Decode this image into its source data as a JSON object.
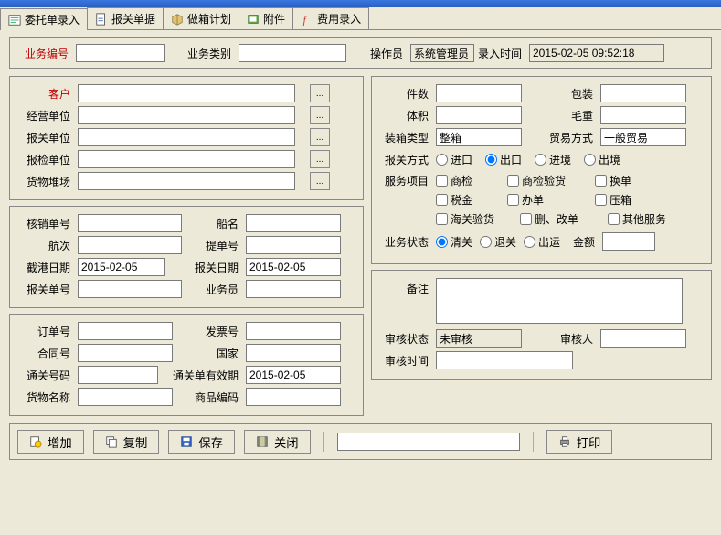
{
  "tabs": [
    {
      "label": "委托单录入",
      "icon": "form-icon"
    },
    {
      "label": "报关单据",
      "icon": "doc-icon"
    },
    {
      "label": "做箱计划",
      "icon": "box-icon"
    },
    {
      "label": "附件",
      "icon": "attach-icon"
    },
    {
      "label": "费用录入",
      "icon": "fee-icon"
    }
  ],
  "header": {
    "biz_no_label": "业务编号",
    "biz_no": "",
    "biz_type_label": "业务类别",
    "biz_type": "",
    "operator_label": "操作员",
    "operator": "系统管理员",
    "entry_time_label": "录入时间",
    "entry_time": "2015-02-05 09:52:18"
  },
  "left_group1": {
    "customer_label": "客户",
    "customer": "",
    "operating_unit_label": "经营单位",
    "operating_unit": "",
    "customs_unit_label": "报关单位",
    "customs_unit": "",
    "inspect_unit_label": "报检单位",
    "inspect_unit": "",
    "cargo_yard_label": "货物堆场",
    "cargo_yard": ""
  },
  "left_group2": {
    "verify_no_label": "核销单号",
    "verify_no": "",
    "ship_name_label": "船名",
    "ship_name": "",
    "voyage_label": "航次",
    "voyage": "",
    "bl_no_label": "提单号",
    "bl_no": "",
    "cutoff_date_label": "截港日期",
    "cutoff_date": "2015-02-05",
    "declare_date_label": "报关日期",
    "declare_date": "2015-02-05",
    "declare_no_label": "报关单号",
    "declare_no": "",
    "clerk_label": "业务员",
    "clerk": ""
  },
  "left_group3": {
    "order_no_label": "订单号",
    "order_no": "",
    "invoice_no_label": "发票号",
    "invoice_no": "",
    "contract_no_label": "合同号",
    "contract_no": "",
    "country_label": "国家",
    "country": "",
    "clearance_no_label": "通关号码",
    "clearance_no": "",
    "clearance_valid_label": "通关单有效期",
    "clearance_valid": "2015-02-05",
    "goods_name_label": "货物名称",
    "goods_name": "",
    "hs_code_label": "商品编码",
    "hs_code": ""
  },
  "right_group1": {
    "pieces_label": "件数",
    "pieces": "",
    "package_label": "包装",
    "package": "",
    "volume_label": "体积",
    "volume": "",
    "gross_label": "毛重",
    "gross": "",
    "container_type_label": "装箱类型",
    "container_type": "整箱",
    "trade_mode_label": "贸易方式",
    "trade_mode": "一般贸易",
    "declare_mode_label": "报关方式",
    "declare_mode_options": [
      "进口",
      "出口",
      "进境",
      "出境"
    ],
    "declare_mode_selected": "出口",
    "service_label": "服务项目",
    "service_options": [
      {
        "label": "商检"
      },
      {
        "label": "商检验货"
      },
      {
        "label": "换单"
      },
      {
        "label": "税金"
      },
      {
        "label": "办单"
      },
      {
        "label": "压箱"
      },
      {
        "label": "海关验货"
      },
      {
        "label": "删、改单"
      },
      {
        "label": "其他服务"
      }
    ],
    "biz_status_label": "业务状态",
    "biz_status_options": [
      "清关",
      "退关",
      "出运"
    ],
    "biz_status_selected": "清关",
    "amount_label": "金额",
    "amount": ""
  },
  "right_group2": {
    "remark_label": "备注",
    "remark": "",
    "audit_status_label": "审核状态",
    "audit_status": "未审核",
    "auditor_label": "审核人",
    "auditor": "",
    "audit_time_label": "审核时间",
    "audit_time": ""
  },
  "buttons": {
    "add": "增加",
    "copy": "复制",
    "save": "保存",
    "close": "关闭",
    "print": "打印"
  },
  "lookup": "..."
}
